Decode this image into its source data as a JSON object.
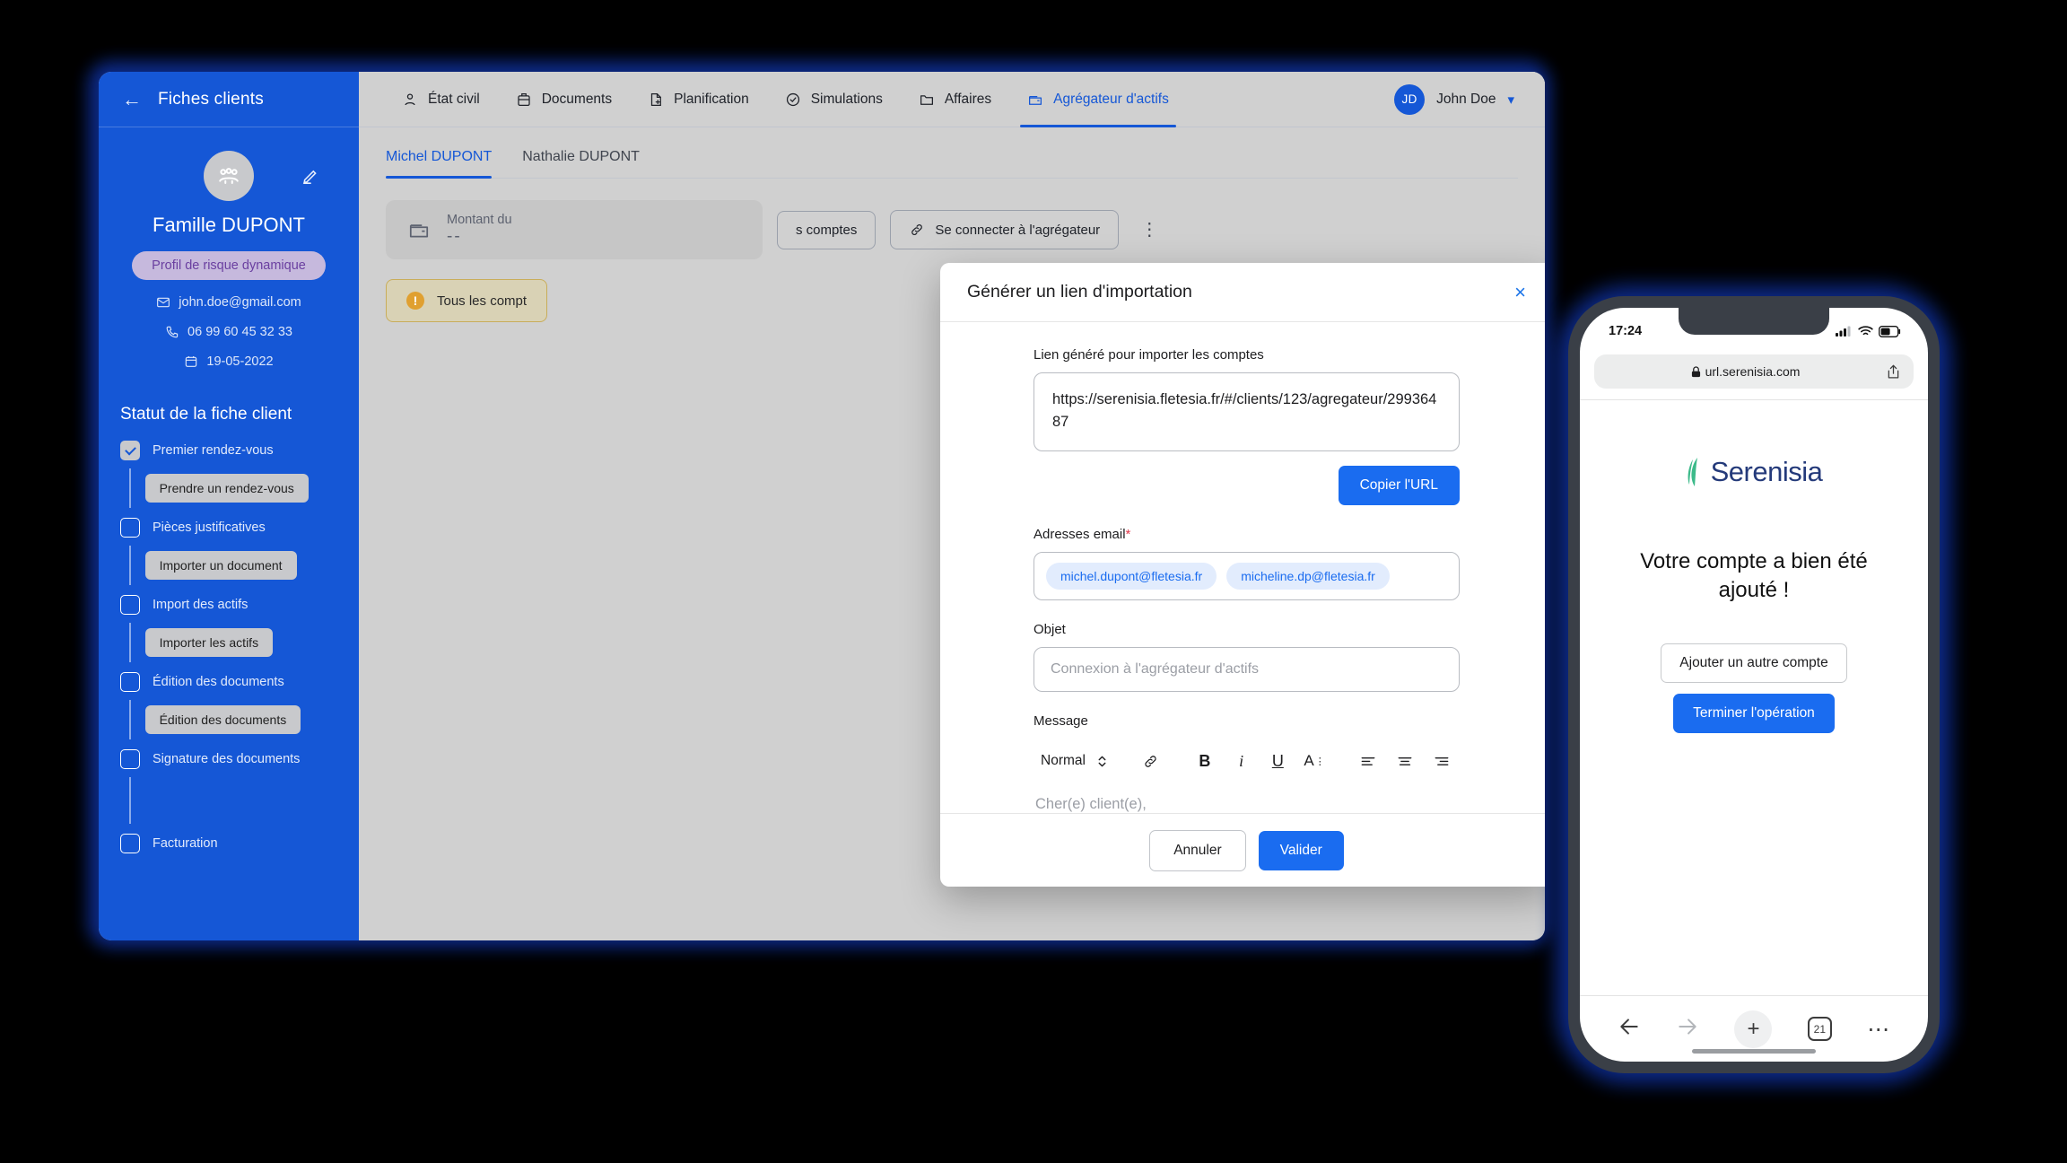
{
  "desktop": {
    "sidebar": {
      "back_icon": "arrow-left-icon",
      "title": "Fiches clients",
      "edit_icon": "pencil-icon",
      "avatar_icon": "family-group-icon",
      "family_name": "Famille DUPONT",
      "risk_badge": "Profil de risque dynamique",
      "contacts": [
        {
          "icon": "mail-icon",
          "value": "john.doe@gmail.com"
        },
        {
          "icon": "phone-icon",
          "value": "06 99 60 45 32 33"
        },
        {
          "icon": "calendar-icon",
          "value": "19-05-2022"
        }
      ],
      "status_title": "Statut de la fiche client",
      "checklist": [
        {
          "label": "Premier rendez-vous",
          "checked": true,
          "action": "Prendre un rendez-vous"
        },
        {
          "label": "Pièces justificatives",
          "checked": false,
          "action": "Importer un document"
        },
        {
          "label": "Import des actifs",
          "checked": false,
          "action": "Importer les actifs"
        },
        {
          "label": "Édition des documents",
          "checked": false,
          "action": "Édition des documents"
        },
        {
          "label": "Signature des documents",
          "checked": false,
          "action": ""
        },
        {
          "label": "Facturation",
          "checked": false,
          "action": null
        }
      ]
    },
    "topnav": {
      "items": [
        {
          "label": "État civil",
          "icon": "person-icon",
          "active": false
        },
        {
          "label": "Documents",
          "icon": "briefcase-icon",
          "active": false
        },
        {
          "label": "Planification",
          "icon": "file-plus-icon",
          "active": false
        },
        {
          "label": "Simulations",
          "icon": "check-circle-icon",
          "active": false
        },
        {
          "label": "Affaires",
          "icon": "folder-icon",
          "active": false
        },
        {
          "label": "Agrégateur d'actifs",
          "icon": "wallet-icon",
          "active": true
        }
      ],
      "user": {
        "initials": "JD",
        "name": "John Doe",
        "chevron_icon": "chevron-down-icon"
      }
    },
    "content": {
      "subtabs": [
        {
          "label": "Michel DUPONT",
          "active": true
        },
        {
          "label": "Nathalie DUPONT",
          "active": false
        }
      ],
      "kpi": {
        "icon": "wallet-icon",
        "label": "Montant du",
        "value": "--"
      },
      "buttons": {
        "accounts_partial": "s comptes",
        "connect": "Se connecter à l'agrégateur",
        "connect_icon": "link-icon",
        "kebab_icon": "kebab-menu-icon"
      },
      "alert": {
        "icon": "warning-icon",
        "text": "Tous les compt"
      }
    },
    "modal": {
      "title": "Générer un lien d'importation",
      "close_icon": "close-icon",
      "link_label": "Lien généré pour importer les comptes",
      "link_value": "https://serenisia.fletesia.fr/#/clients/123/agregateur/29936487",
      "copy_button": "Copier l'URL",
      "email_label": "Adresses email",
      "email_required_mark": "*",
      "email_chips": [
        "michel.dupont@fletesia.fr",
        "micheline.dp@fletesia.fr"
      ],
      "objet_label": "Objet",
      "objet_placeholder": "Connexion à l'agrégateur d'actifs",
      "objet_value": "",
      "message_label": "Message",
      "editor": {
        "style_value": "Normal",
        "style_chevron_icon": "chevron-updown-icon",
        "tools": [
          {
            "icon": "link-icon",
            "label": "Lien"
          },
          {
            "icon": "bold-icon",
            "label": "B"
          },
          {
            "icon": "italic-icon",
            "label": "i"
          },
          {
            "icon": "underline-icon",
            "label": "U"
          },
          {
            "icon": "text-size-icon",
            "label": "A"
          },
          {
            "icon": "align-left-icon",
            "label": ""
          },
          {
            "icon": "align-center-icon",
            "label": ""
          },
          {
            "icon": "align-right-icon",
            "label": ""
          }
        ],
        "body_placeholder": "Cher(e) client(e),"
      },
      "cancel_button": "Annuler",
      "validate_button": "Valider"
    }
  },
  "phone": {
    "status": {
      "time": "17:24",
      "signal_icon": "cellular-signal-icon",
      "wifi_icon": "wifi-icon",
      "battery_icon": "battery-icon"
    },
    "urlbar": {
      "lock_icon": "lock-icon",
      "url": "url.serenisia.com",
      "share_icon": "share-icon"
    },
    "brand": {
      "logo_icon": "serenisia-leaf-icon",
      "name": "Serenisia"
    },
    "headline": "Votre compte a bien été ajouté !",
    "secondary_button": "Ajouter un autre compte",
    "primary_button": "Terminer l'opération",
    "toolbar": {
      "back_icon": "arrow-left-icon",
      "forward_icon": "arrow-right-icon",
      "new_tab_icon": "plus-icon",
      "tabs_count": "21",
      "more_icon": "ellipsis-icon"
    }
  },
  "colors": {
    "brand_blue": "#1557D6",
    "accent_blue": "#1a6cf0",
    "risk_badge_bg": "#c6b9dd",
    "risk_badge_text": "#6a3fa0",
    "warning": "#e0a030",
    "leaf_green": "#3cba8a",
    "logo_navy": "#243a7a"
  }
}
